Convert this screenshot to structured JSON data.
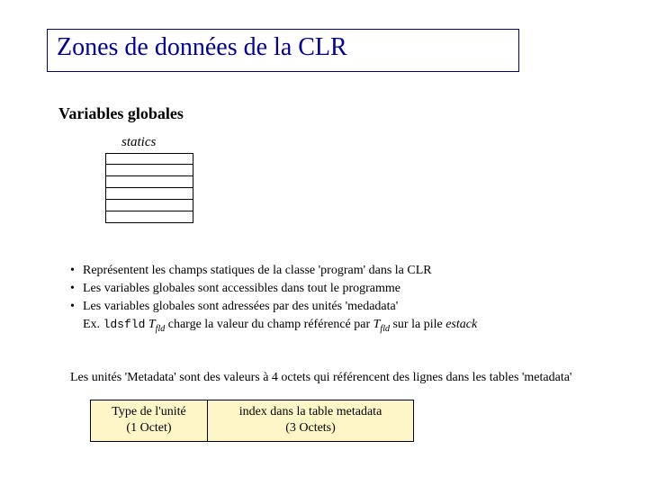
{
  "title": "Zones de données de la CLR",
  "subheading": "Variables globales",
  "statics_label": "statics",
  "statics_rows": 6,
  "bullets": {
    "b1": "Représentent les champs statiques de la classe 'program' dans la CLR",
    "b2": "Les variables globales sont accessibles dans tout le programme",
    "b3": "Les variables globales sont adressées  par des unités 'medadata'",
    "ex_prefix": "Ex. ",
    "ex_instr": "ldsfld",
    "ex_space": " ",
    "ex_T": "T",
    "ex_sub": "fld",
    "ex_mid": " charge la valeur du champ référencé par ",
    "ex_T2": "T",
    "ex_sub2": "fld",
    "ex_mid2": " sur la pile ",
    "ex_estack": "estack"
  },
  "meta_sentence": "Les unités 'Metadata' sont des valeurs à 4 octets  qui référencent des lignes dans les tables 'metadata'",
  "token": {
    "left_line1": "Type de l'unité",
    "left_line2": "(1 Octet)",
    "right_line1": "index dans la table metadata",
    "right_line2": "(3 Octets)"
  }
}
